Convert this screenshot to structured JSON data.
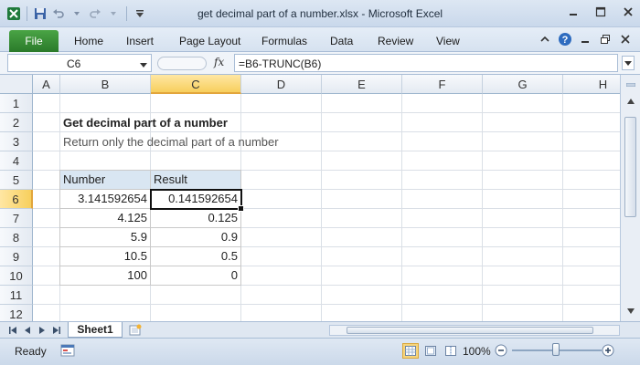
{
  "window": {
    "title": "get decimal part of a number.xlsx  -  Microsoft Excel"
  },
  "ribbon": {
    "tabs": [
      "File",
      "Home",
      "Insert",
      "Page Layout",
      "Formulas",
      "Data",
      "Review",
      "View"
    ]
  },
  "formula_bar": {
    "name_box": "C6",
    "fx_label": "fx",
    "formula": "=B6-TRUNC(B6)"
  },
  "grid": {
    "columns": [
      "A",
      "B",
      "C",
      "D",
      "E",
      "F",
      "G",
      "H"
    ],
    "selected_column": "C",
    "rows": [
      "1",
      "2",
      "3",
      "4",
      "5",
      "6",
      "7",
      "8",
      "9",
      "10",
      "11",
      "12"
    ],
    "selected_row": "6",
    "title": "Get decimal part of a number",
    "subtitle": "Return only the decimal part of a number",
    "table": {
      "headers": [
        "Number",
        "Result"
      ],
      "rows": [
        [
          "3.141592654",
          "0.141592654"
        ],
        [
          "4.125",
          "0.125"
        ],
        [
          "5.9",
          "0.9"
        ],
        [
          "10.5",
          "0.5"
        ],
        [
          "100",
          "0"
        ]
      ]
    }
  },
  "sheets": {
    "active": "Sheet1"
  },
  "status": {
    "text": "Ready",
    "zoom": "100%",
    "zoom_percent": 100
  },
  "colors": {
    "file_tab": "#2a7a2a",
    "selected_header": "#f7cf5d",
    "table_header_fill": "#d9e6f2"
  }
}
